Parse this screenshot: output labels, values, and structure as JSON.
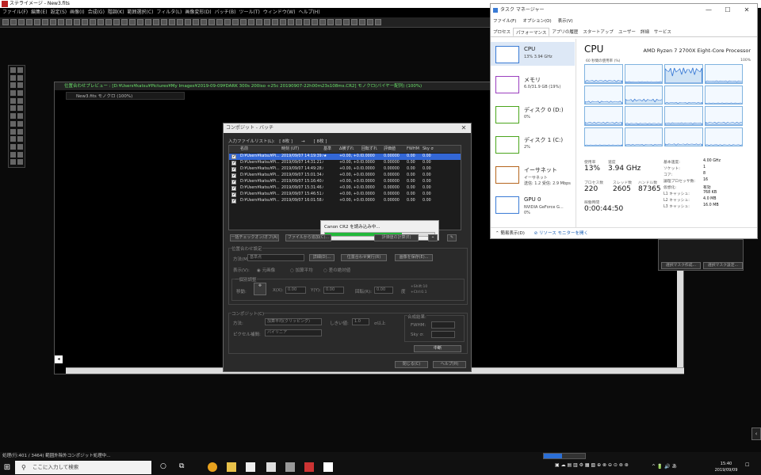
{
  "app": {
    "title": "ステライメージ - New3.fits",
    "menu": [
      "ファイル(F)",
      "編集(E)",
      "設定(S)",
      "画像(I)",
      "合成(G)",
      "階調(K)",
      "範囲選択(C)",
      "フィルタ(L)",
      "画像変形(D)",
      "バッチ(B)",
      "ツール(T)",
      "ウィンドウ(W)",
      "ヘルプ(H)"
    ]
  },
  "preview": {
    "title": "位置合わせプレビュー : [D:¥Users¥katsu¥Pictures¥My Images¥2019-09-09¥DARK 300s 200iso +25c 20190907-22h00m23s108ms.CR2] モノクロ(バイヤー配列) (100%)",
    "subwindow": "New3.fits モノクロ (100%)",
    "left_arrow": "◂"
  },
  "dialog": {
    "title": "コンポジット - バッチ",
    "close": "✕",
    "files_label": "入力ファイルリスト(L):　[ 8枚 ]　　→　　[ 8枚 ]",
    "columns": [
      "名前",
      "時刻 (UT)",
      "基準",
      "Δ横ずれ",
      "回転ずれ",
      "評価値",
      "FWHM",
      "Sky σ"
    ],
    "rows": [
      {
        "name": "D:¥Users¥katsu¥Pi...",
        "time": "2019/09/07 14:19:39.00",
        "ref": "★",
        "shift": "+0.00, +0.00",
        "rot": "0.0000",
        "score": "0.00000",
        "fwhm": "0.00",
        "sky": "0.00",
        "selected": true
      },
      {
        "name": "D:¥Users¥katsu¥Pi...",
        "time": "2019/09/07 14:31:21.00",
        "ref": "",
        "shift": "+0.00, +0.00",
        "rot": "0.0000",
        "score": "0.00000",
        "fwhm": "0.00",
        "sky": "0.00",
        "selected": false
      },
      {
        "name": "D:¥Users¥katsu¥Pi...",
        "time": "2019/09/07 14:49:28.00",
        "ref": "",
        "shift": "+0.00, +0.00",
        "rot": "0.0000",
        "score": "0.00000",
        "fwhm": "0.00",
        "sky": "0.00",
        "selected": false
      },
      {
        "name": "D:¥Users¥katsu¥Pi...",
        "time": "2019/09/07 15:01:34.00",
        "ref": "",
        "shift": "+0.00, +0.00",
        "rot": "0.0000",
        "score": "0.00000",
        "fwhm": "0.00",
        "sky": "0.00",
        "selected": false
      },
      {
        "name": "D:¥Users¥katsu¥Pi...",
        "time": "2019/09/07 15:16:40.00",
        "ref": "",
        "shift": "+0.00, +0.00",
        "rot": "0.0000",
        "score": "0.00000",
        "fwhm": "0.00",
        "sky": "0.00",
        "selected": false
      },
      {
        "name": "D:¥Users¥katsu¥Pi...",
        "time": "2019/09/07 15:31:46.00",
        "ref": "",
        "shift": "+0.00, +0.00",
        "rot": "0.0000",
        "score": "0.00000",
        "fwhm": "0.00",
        "sky": "0.00",
        "selected": false
      },
      {
        "name": "D:¥Users¥katsu¥Pi...",
        "time": "2019/09/07 15:46:51.00",
        "ref": "",
        "shift": "+0.00, +0.00",
        "rot": "0.0000",
        "score": "0.00000",
        "fwhm": "0.00",
        "sky": "0.00",
        "selected": false
      },
      {
        "name": "D:¥Users¥katsu¥Pi...",
        "time": "2019/09/07 16:01:58.00",
        "ref": "",
        "shift": "+0.00, +0.00",
        "rot": "0.0000",
        "score": "0.00000",
        "fwhm": "0.00",
        "sky": "0.00",
        "selected": false
      }
    ],
    "progress": {
      "message": "Canon CR2 を読み込み中...",
      "percent": 70
    },
    "btn_check_all": "一括チェックオン/オフ(A)",
    "btn_add_files": "ファイルから追加(C)...",
    "btn_evaluate": "評価値の計算(E)",
    "align_group": "位置合わせ設定",
    "method_label": "方法(M):",
    "method_value": "基準点",
    "btn_detail": "詳細(D)...",
    "btn_run_align": "位置合わせ実行(R)",
    "btn_reset": "画像を保存(E)...",
    "display_label": "表示(V):",
    "display_opts": [
      "元画像",
      "加算平均",
      "差の絶対値"
    ],
    "manual_group": "一個別調整",
    "move_label": "移動:",
    "x_label": "X(X):",
    "x_value": "0.00",
    "y_label": "Y(Y):",
    "y_value": "0.00",
    "rot_label": "回転(R):",
    "rot_value": "0.00",
    "rot_unit": "度",
    "hint1": "+Shift:10",
    "hint2": "+Ctrl:0.1",
    "composite_group": "コンポジット(C)",
    "comp_method_label": "方法:",
    "comp_method_value": "加算平均(クリッピング)",
    "sigma_label": "しきい値:",
    "sigma_value": "1.0",
    "sigma_unit": "σ以上",
    "interp_label": "ピクセル補間:",
    "interp_value": "バイリニア",
    "result_group": "合成結果:",
    "fwhm_label": "FWHM:",
    "skysigma_label": "Sky σ:",
    "btn_abort": "中断",
    "btn_close": "閉じる(C)",
    "btn_help": "ヘルプ(H)"
  },
  "taskmgr": {
    "title": "タスク マネージャー",
    "controls": [
      "—",
      "☐",
      "✕"
    ],
    "menu": [
      "ファイル(F)",
      "オプション(O)",
      "表示(V)"
    ],
    "tabs": [
      "プロセス",
      "パフォーマンス",
      "アプリの履歴",
      "スタートアップ",
      "ユーザー",
      "詳細",
      "サービス"
    ],
    "active_tab": 1,
    "side": [
      {
        "name": "CPU",
        "sub": "13%  3.94 GHz",
        "sub2": "",
        "color": "#3a7bd5"
      },
      {
        "name": "メモリ",
        "sub": "6.0/31.9 GB (19%)",
        "sub2": "",
        "color": "#9b3fbf"
      },
      {
        "name": "ディスク 0 (D:)",
        "sub": "0%",
        "sub2": "",
        "color": "#4aa51c"
      },
      {
        "name": "ディスク 1 (C:)",
        "sub": "2%",
        "sub2": "",
        "color": "#4aa51c"
      },
      {
        "name": "イーサネット",
        "sub": "イーサネット",
        "sub2": "送信: 1.2  受信: 2.9 Mbps",
        "color": "#b5651d"
      },
      {
        "name": "GPU 0",
        "sub": "NVIDIA GeForce G...",
        "sub2": "0%",
        "color": "#3a7bd5"
      }
    ],
    "cpu_heading": "CPU",
    "cpu_model": "AMD Ryzen 7 2700X Eight-Core Processor",
    "graph_caption": "60 秒間の使用率 (%)",
    "graph_max": "100%",
    "core_usage": [
      0.1,
      0.05,
      0.6,
      0.08,
      0.12,
      0.2,
      0.07,
      0.05,
      0.1,
      0.06,
      0.08,
      0.1,
      0.05,
      0.07,
      0.09,
      0.06
    ],
    "usage_label": "使用率",
    "usage_value": "13%",
    "speed_label": "速度",
    "speed_value": "3.94 GHz",
    "proc_label": "プロセス数",
    "proc_value": "220",
    "thread_label": "スレッド数",
    "thread_value": "2605",
    "handle_label": "ハンドル数",
    "handle_value": "87365",
    "uptime_label": "稼働時間",
    "uptime_value": "0:00:44:50",
    "specs": [
      [
        "基本速度:",
        "4.00 GHz"
      ],
      [
        "ソケット:",
        "1"
      ],
      [
        "コア:",
        "8"
      ],
      [
        "論理プロセッサ数:",
        "16"
      ],
      [
        "仮想化:",
        "有効"
      ],
      [
        "L1 キャッシュ:",
        "768 KB"
      ],
      [
        "L2 キャッシュ:",
        "4.0 MB"
      ],
      [
        "L3 キャッシュ:",
        "16.0 MB"
      ]
    ],
    "footer_brief": "簡易表示(D)",
    "footer_monitor": "リソース モニターを開く"
  },
  "mask_panel": {
    "btn1": "選択マスク作成...",
    "btn2": "選択マスク設定..."
  },
  "statusbar": {
    "text": "処理(行:401 / 3464) 範囲外除外コンポジット処理中...",
    "percent": 45
  },
  "taskbar": {
    "search_placeholder": "ここに入力して検索",
    "clock_time": "15:40",
    "clock_date": "2019/09/09",
    "tray_text": "^ 🔋 🔊 あ"
  }
}
